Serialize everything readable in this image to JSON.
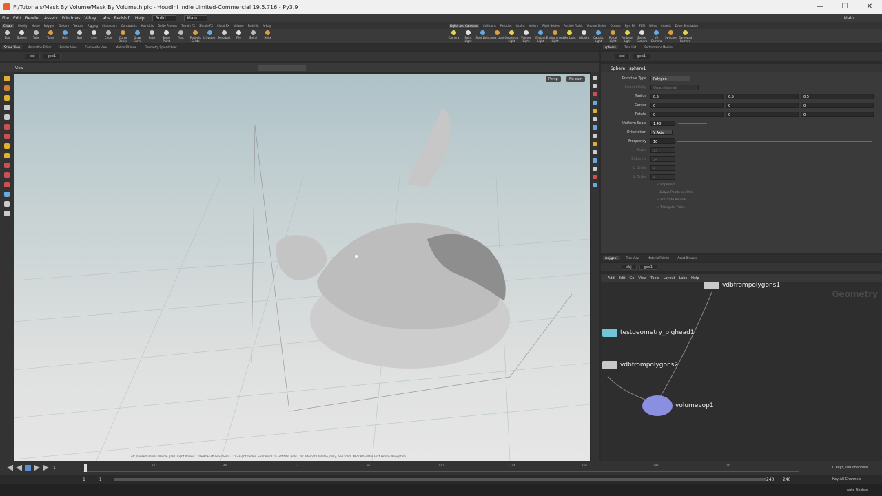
{
  "window": {
    "title": "F:/Tutorials/Mask By Volume/Mask By Volume.hiplc - Houdini Indie Limited-Commercial 19.5.716 - Py3.9"
  },
  "menu": {
    "items": [
      "File",
      "Edit",
      "Render",
      "Assets",
      "Windows",
      "V-Ray",
      "Labs",
      "Redshift",
      "Help"
    ],
    "desktop": "Build",
    "context": "Main",
    "right_label": "Main"
  },
  "shelf_tabs_left": [
    "Create",
    "Modify",
    "Model",
    "Polygon",
    "Deform",
    "Texture",
    "Rigging",
    "Characters",
    "Constraints",
    "Hair Utils",
    "Guide Process",
    "Terrain FX",
    "Simple FX",
    "Cloud FX",
    "Volume",
    "Redshift",
    "V-Ray"
  ],
  "shelf_tools_left": [
    "Box",
    "Sphere",
    "Tube",
    "Torus",
    "Grid",
    "Null",
    "Line",
    "Circle",
    "Curve Bezier",
    "Draw Curve",
    "Path",
    "Spray Paint",
    "Font",
    "Platonic Solids",
    "L-System",
    "Metaball",
    "File",
    "Spiral",
    "Helix"
  ],
  "shelf_tabs_right": [
    "Lights and Cameras",
    "Collisions",
    "Particles",
    "Grains",
    "Vellum",
    "Rigid Bodies",
    "Particle Fluids",
    "Viscous Fluids",
    "Oceans",
    "Pyro FX",
    "FEM",
    "Wires",
    "Crowds",
    "Drive Simulation"
  ],
  "shelf_tools_right": [
    "Camera",
    "Point Light",
    "Spot Light",
    "Area Light",
    "Geometry Light",
    "Volume Light",
    "Distant Light",
    "Environment Light",
    "Sky Light",
    "GI Light",
    "Caustic Light",
    "Portal Light",
    "Ambient Light",
    "Stereo Camera",
    "VR Camera",
    "Switcher",
    "Gamepad Camera"
  ],
  "left_pane_tabs": [
    "Scene View",
    "Animation Editor",
    "Render View",
    "Composite View",
    "Motion FX View",
    "Geometry Spreadsheet"
  ],
  "right_pane_tabs": [
    "sphere1",
    "Take List",
    "Performance Monitor"
  ],
  "path": {
    "obj": "obj",
    "geo": "geo1"
  },
  "viewport": {
    "label": "View",
    "persp": "Persp",
    "cam": "No cam",
    "status": "Left mouse tumbles. Middle pans. Right dollies. Ctrl+Alt+Left box-zooms. Ctrl+Right zooms. Spacebar-Ctrl-Left tilts. Hold L for alternate tumble, dolly, and zoom.    M or Alt+M for First Person Navigation."
  },
  "params": {
    "node_type": "Sphere",
    "node_name": "sphere1",
    "primitive_type_label": "Primitive Type",
    "primitive_type": "Polygon",
    "connectivity_label": "Connectivity",
    "connectivity": "Quadrilaterals",
    "radius_label": "Radius",
    "radius": [
      "0.5",
      "0.5",
      "0.5"
    ],
    "center_label": "Center",
    "center": [
      "0",
      "0",
      "0"
    ],
    "rotate_label": "Rotate",
    "rotate": [
      "0",
      "0",
      "0"
    ],
    "uniform_scale_label": "Uniform Scale",
    "uniform_scale": "1.48",
    "orientation_label": "Orientation",
    "orientation": "Y Axis",
    "frequency_label": "Frequency",
    "frequency": "10",
    "rows_label": "Rows",
    "rows": "13",
    "columns_label": "Columns",
    "columns": "24",
    "uorder_label": "U Order",
    "uorder": "4",
    "vorder_label": "V Order",
    "vorder": "4",
    "checks": [
      "Imperfect",
      "Unique Points per Pole",
      "Accurate Bounds",
      "Triangular Poles"
    ]
  },
  "network": {
    "tabs": [
      "/obj/geo1",
      "Tree View",
      "Material Palette",
      "Asset Browser"
    ],
    "menu": [
      "Add",
      "Edit",
      "Go",
      "View",
      "Tools",
      "Layout",
      "Labs",
      "Help"
    ],
    "watermark": "Geometry",
    "nodes": [
      {
        "name": "vdbfrompolygons1",
        "color": "#c9c9c9"
      },
      {
        "name": "testgeometry_pighead1",
        "color": "#6fc6d8"
      },
      {
        "name": "vdbfrompolygons2",
        "color": "#c9c9c9"
      },
      {
        "name": "volumevop1",
        "color": "#8a8fe0"
      }
    ]
  },
  "timeline": {
    "frame": "1",
    "start": "1",
    "end_a": "240",
    "end_b": "240",
    "ticks": [
      "1",
      "24",
      "48",
      "72",
      "96",
      "120",
      "144",
      "168",
      "192",
      "216"
    ],
    "keys": "0 keys, 0/0 channels",
    "key_all": "Key All Channels",
    "auto_update": "Auto Update"
  }
}
